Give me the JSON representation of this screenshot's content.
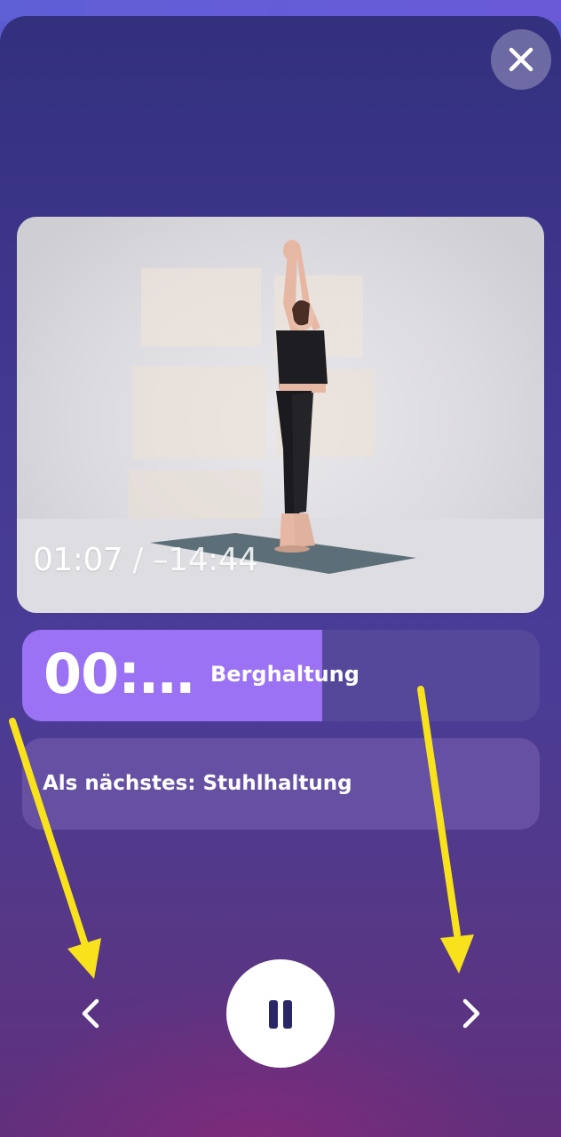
{
  "player": {
    "close_icon": "close-icon",
    "video": {
      "elapsed": "01:07",
      "separator": "/",
      "remaining": "–14:44"
    }
  },
  "current_exercise": {
    "timer": "00:…",
    "name": "Berghaltung",
    "progress_fraction": 0.58,
    "accent_color": "#9a72f3"
  },
  "next_exercise": {
    "label": "Als nächstes: Stuhlhaltung"
  },
  "controls": {
    "previous_icon": "chevron-left-icon",
    "pause_icon": "pause-icon",
    "next_icon": "chevron-right-icon"
  },
  "annotations": {
    "arrow_color": "#f7e21c",
    "arrows": [
      "arrow-to-previous-button",
      "arrow-to-next-button"
    ]
  }
}
